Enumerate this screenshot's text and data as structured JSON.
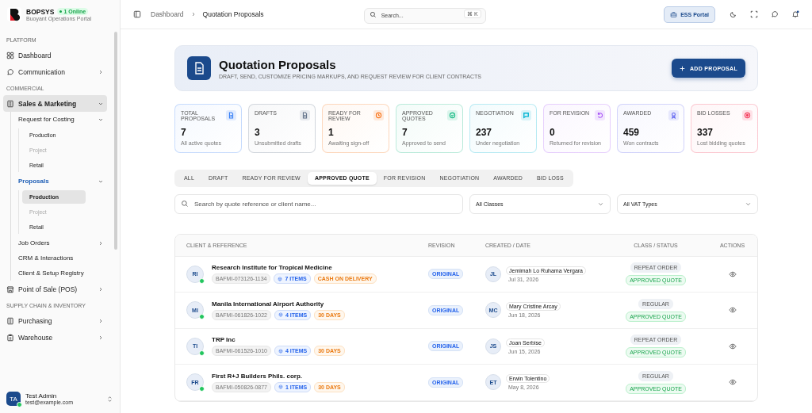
{
  "brand": {
    "name": "BOPSYS",
    "online": "1 Online",
    "subtitle": "Buoyant Operations Portal"
  },
  "sidebar": {
    "sections": [
      {
        "title": "PLATFORM",
        "items": [
          {
            "label": "Dashboard",
            "selected": false
          },
          {
            "label": "Communication",
            "selected": false,
            "expanded": false
          }
        ]
      },
      {
        "title": "COMMERCIAL",
        "items": [
          {
            "label": "Sales & Marketing",
            "selected": true,
            "expanded": true,
            "children": [
              {
                "label": "Request for Costing",
                "selected": false,
                "expanded": true,
                "children": [
                  {
                    "label": "Production",
                    "selected": false,
                    "disabled": false
                  },
                  {
                    "label": "Project",
                    "selected": false,
                    "disabled": true
                  },
                  {
                    "label": "Retail",
                    "selected": false,
                    "disabled": false
                  }
                ]
              },
              {
                "label": "Proposals",
                "selected": true,
                "expanded": true,
                "children": [
                  {
                    "label": "Production",
                    "selected": true,
                    "disabled": false
                  },
                  {
                    "label": "Project",
                    "selected": false,
                    "disabled": true
                  },
                  {
                    "label": "Retail",
                    "selected": false,
                    "disabled": false
                  }
                ]
              },
              {
                "label": "Job Orders",
                "selected": false,
                "expanded": false
              },
              {
                "label": "CRM & Interactions",
                "selected": false
              },
              {
                "label": "Client & Setup Registry",
                "selected": false
              }
            ]
          },
          {
            "label": "Point of Sale (POS)",
            "selected": false,
            "expanded": false
          }
        ]
      },
      {
        "title": "SUPPLY CHAIN & INVENTORY",
        "items": [
          {
            "label": "Purchasing",
            "selected": false,
            "expanded": false
          },
          {
            "label": "Warehouse",
            "selected": false,
            "expanded": false
          }
        ]
      }
    ]
  },
  "user": {
    "initials": "TA",
    "name": "Test Admin",
    "email": "test@example.com",
    "online": true
  },
  "header": {
    "breadcrumb": [
      "Dashboard",
      "Quotation Proposals"
    ],
    "search": {
      "placeholder": "Search...",
      "shortcut": "⌘ K"
    },
    "portal_button": "ESS Portal",
    "notifications_unread": true
  },
  "hero": {
    "title": "Quotation Proposals",
    "subtitle": "DRAFT, SEND, CUSTOMIZE PRICING MARKUPS, AND REQUEST REVIEW FOR CLIENT CONTRACTS",
    "button": "ADD PROPOSAL"
  },
  "stats": [
    {
      "label": "TOTAL PROPOSALS",
      "value": "7",
      "caption": "All active quotes",
      "color": "#3b82f6"
    },
    {
      "label": "DRAFTS",
      "value": "3",
      "caption": "Unsubmitted drafts",
      "color": "#64748b"
    },
    {
      "label": "READY FOR REVIEW",
      "value": "1",
      "caption": "Awaiting sign-off",
      "color": "#f97316"
    },
    {
      "label": "APPROVED QUOTES",
      "value": "7",
      "caption": "Approved to send",
      "color": "#10b981"
    },
    {
      "label": "NEGOTIATION",
      "value": "237",
      "caption": "Under negotiation",
      "color": "#06b6d4"
    },
    {
      "label": "FOR REVISION",
      "value": "0",
      "caption": "Returned for revision",
      "color": "#a855f7"
    },
    {
      "label": "AWARDED",
      "value": "459",
      "caption": "Won contracts",
      "color": "#6366f1"
    },
    {
      "label": "BID LOSSES",
      "value": "337",
      "caption": "Lost bidding quotes",
      "color": "#f43f5e"
    }
  ],
  "tabs": [
    {
      "label": "ALL",
      "selected": false
    },
    {
      "label": "DRAFT",
      "selected": false
    },
    {
      "label": "READY FOR REVIEW",
      "selected": false
    },
    {
      "label": "APPROVED QUOTE",
      "selected": true
    },
    {
      "label": "FOR REVISION",
      "selected": false
    },
    {
      "label": "NEGOTIATION",
      "selected": false
    },
    {
      "label": "AWARDED",
      "selected": false
    },
    {
      "label": "BID LOSS",
      "selected": false
    }
  ],
  "filters": {
    "search": {
      "placeholder": "Search by quote reference or client name..."
    },
    "class_select": "All Classes",
    "vat_select": "All VAT Types"
  },
  "table": {
    "columns": [
      "CLIENT & REFERENCE",
      "REVISION",
      "CREATED / DATE",
      "CLASS / STATUS",
      "ACTIONS"
    ],
    "rows": [
      {
        "initials": "RI",
        "online": true,
        "client": "Research Institute for Tropical Medicine",
        "reference": "BAFMI-073126-1134",
        "items": "7 ITEMS",
        "terms": "CASH ON DELIVERY",
        "revision": "ORIGINAL",
        "creator_initials": "JL",
        "creator": "Jemimah Lo Ruhama Vergara",
        "date": "Jul 31, 2026",
        "class": "REPEAT ORDER",
        "status": "APPROVED QUOTE"
      },
      {
        "initials": "MI",
        "online": true,
        "client": "Manila International Airport Authority",
        "reference": "BAFMI-061826-1022",
        "items": "4 ITEMS",
        "terms": "30 DAYS",
        "revision": "ORIGINAL",
        "creator_initials": "MC",
        "creator": "Mary Cristine Arcay",
        "date": "Jun 18, 2026",
        "class": "REGULAR",
        "status": "APPROVED QUOTE"
      },
      {
        "initials": "TI",
        "online": true,
        "client": "TRP Inc",
        "reference": "BAFMI-061526-1010",
        "items": "4 ITEMS",
        "terms": "30 DAYS",
        "revision": "ORIGINAL",
        "creator_initials": "JS",
        "creator": "Joan Serbise",
        "date": "Jun 15, 2026",
        "class": "REPEAT ORDER",
        "status": "APPROVED QUOTE"
      },
      {
        "initials": "FR",
        "online": true,
        "client": "First R+J Builders Phils. corp.",
        "reference": "BAFMI-050826-0877",
        "items": "1 ITEMS",
        "terms": "30 DAYS",
        "revision": "ORIGINAL",
        "creator_initials": "ET",
        "creator": "Erwin Tolentino",
        "date": "May 8, 2026",
        "class": "REGULAR",
        "status": "APPROVED QUOTE"
      }
    ]
  }
}
